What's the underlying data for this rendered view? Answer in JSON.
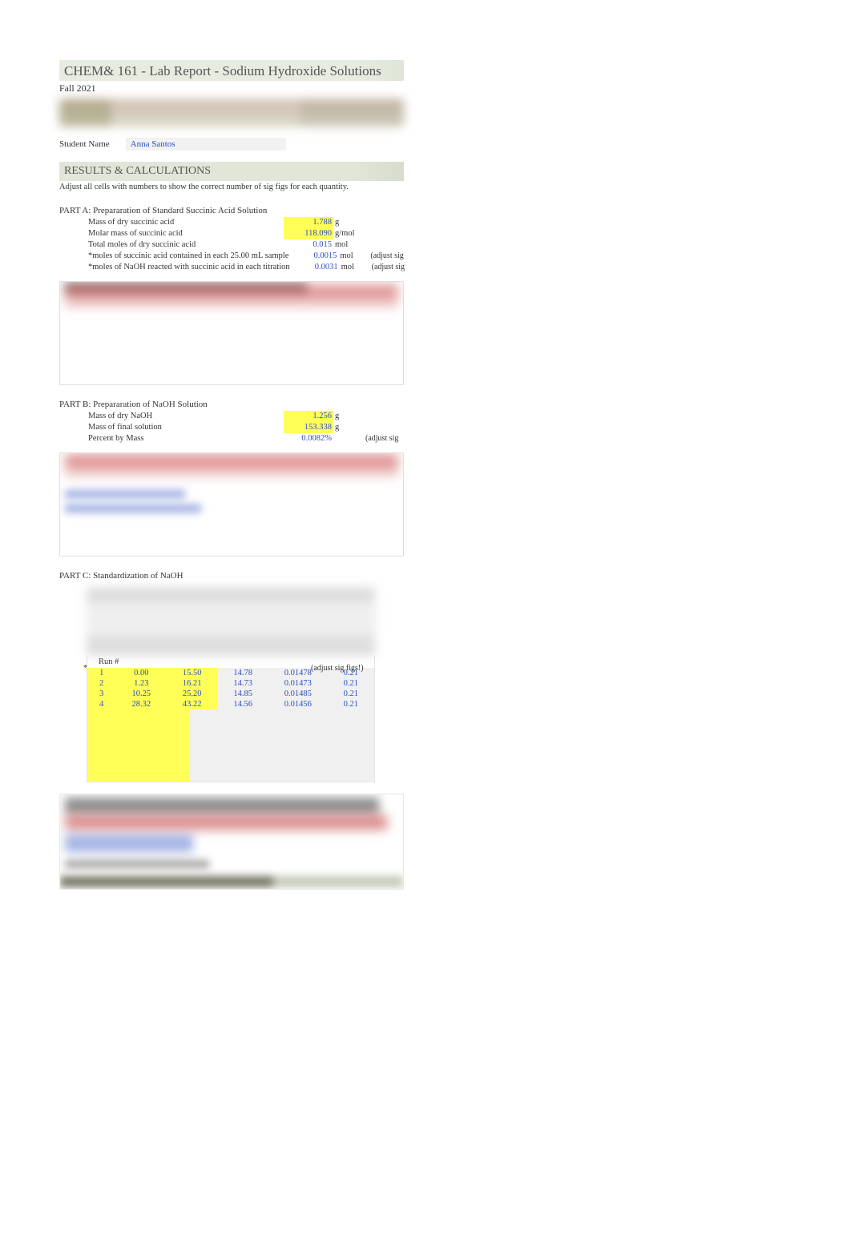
{
  "header": {
    "title": "CHEM& 161 - Lab Report - Sodium Hydroxide Solutions",
    "term": "Fall 2021"
  },
  "student": {
    "label": "Student Name",
    "name": "Anna Santos"
  },
  "results_header": "RESULTS & CALCULATIONS",
  "results_note": "Adjust all cells with numbers to show the correct number of sig figs for each quantity.",
  "partA": {
    "title": "PART A: Prepararation of Standard Succinic Acid Solution",
    "rows": [
      {
        "label": "Mass of dry succinic acid",
        "value": "1.788",
        "unit": "g",
        "hl": true,
        "note": ""
      },
      {
        "label": "Molar mass of succinic acid",
        "value": "118.090",
        "unit": "g/mol",
        "hl": true,
        "note": ""
      },
      {
        "label": "Total moles of dry succinic acid",
        "value": "0.015",
        "unit": "mol",
        "hl": false,
        "note": ""
      },
      {
        "label": "*moles of succinic acid contained in each 25.00 mL sample",
        "value": "0.0015",
        "unit": "mol",
        "hl": false,
        "note": "(adjust sig"
      },
      {
        "label": "*moles of NaOH reacted with succinic acid in each titration",
        "value": "0.0031",
        "unit": "mol",
        "hl": false,
        "note": "(adjust sig"
      }
    ]
  },
  "partB": {
    "title": "PART B: Prepararation of NaOH Solution",
    "rows": [
      {
        "label": "Mass of dry NaOH",
        "value": "1.256",
        "unit": "g",
        "hl": true,
        "note": ""
      },
      {
        "label": "Mass of final solution",
        "value": "153.338",
        "unit": "g",
        "hl": true,
        "note": ""
      },
      {
        "label": "Percent by Mass",
        "value": "0.0082%",
        "unit": "",
        "hl": false,
        "note": "(adjust sig"
      }
    ]
  },
  "partC": {
    "title": "PART C: Standardization of NaOH",
    "run_header": "Run #",
    "adjust_note": "(adjust sig figs!)",
    "star": "*",
    "runs": [
      {
        "n": "1",
        "a": "0.00",
        "b": "15.50",
        "c": "14.78",
        "d": "0.01478",
        "e": "0.21"
      },
      {
        "n": "2",
        "a": "1.23",
        "b": "16.21",
        "c": "14.73",
        "d": "0.01473",
        "e": "0.21"
      },
      {
        "n": "3",
        "a": "10.25",
        "b": "25.20",
        "c": "14.85",
        "d": "0.01485",
        "e": "0.21"
      },
      {
        "n": "4",
        "a": "28.32",
        "b": "43.22",
        "c": "14.56",
        "d": "0.01456",
        "e": "0.21"
      }
    ]
  }
}
